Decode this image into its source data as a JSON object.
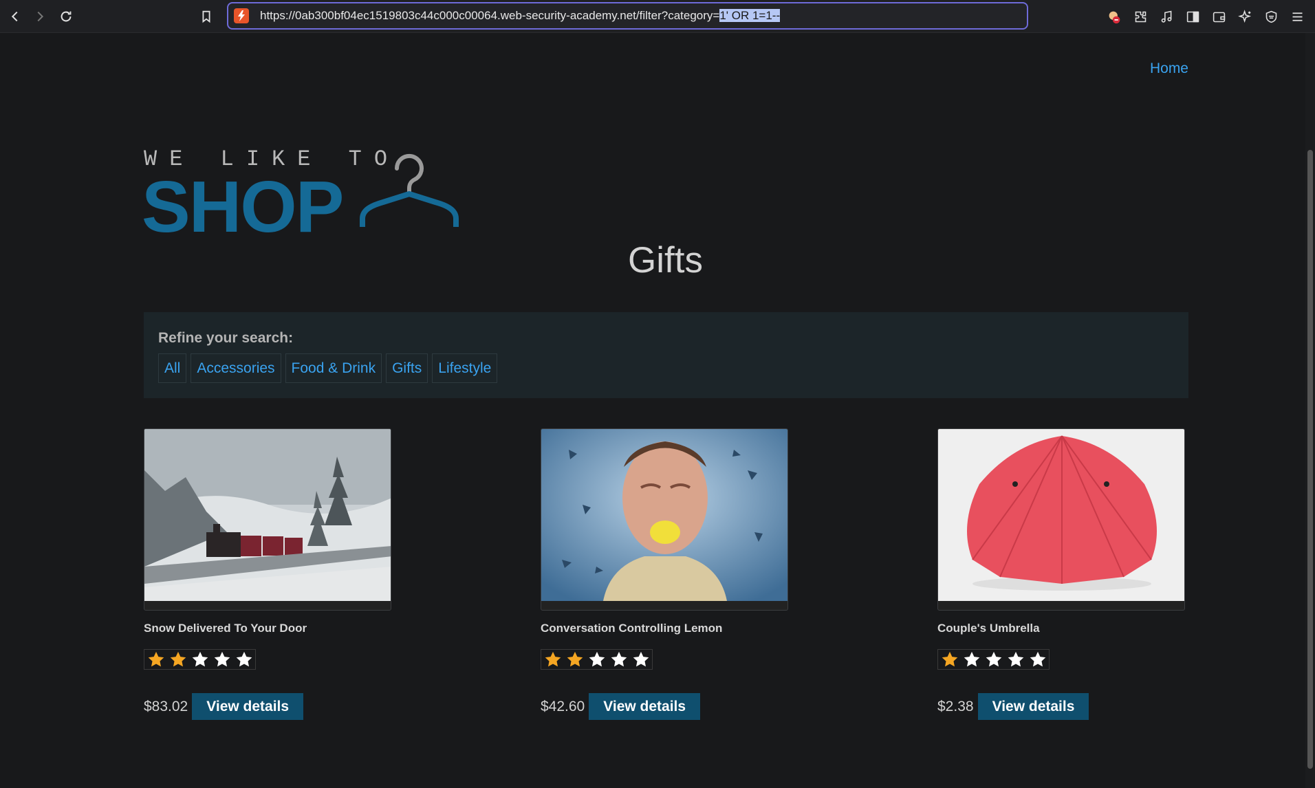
{
  "browser": {
    "url_base": "https://0ab300bf04ec1519803c44c000c00064.web-security-academy.net/filter?category=",
    "url_highlight": "1' OR 1=1--"
  },
  "nav": {
    "home_label": "Home"
  },
  "logo": {
    "top_text": "WE LIKE TO",
    "main_text": "SHOP"
  },
  "page_title": "Gifts",
  "refine": {
    "label": "Refine your search:",
    "filters": [
      "All",
      "Accessories",
      "Food & Drink",
      "Gifts",
      "Lifestyle"
    ]
  },
  "products": [
    {
      "name": "Snow Delivered To Your Door",
      "rating": 2,
      "max_rating": 5,
      "price": "$83.02",
      "button": "View details"
    },
    {
      "name": "Conversation Controlling Lemon",
      "rating": 2,
      "max_rating": 5,
      "price": "$42.60",
      "button": "View details"
    },
    {
      "name": "Couple's Umbrella",
      "rating": 1,
      "max_rating": 5,
      "price": "$2.38",
      "button": "View details"
    }
  ],
  "colors": {
    "accent": "#156a96",
    "link": "#3aa3f0",
    "button": "#0f4f6e",
    "star_on": "#f5a623",
    "star_off": "#ffffff"
  }
}
